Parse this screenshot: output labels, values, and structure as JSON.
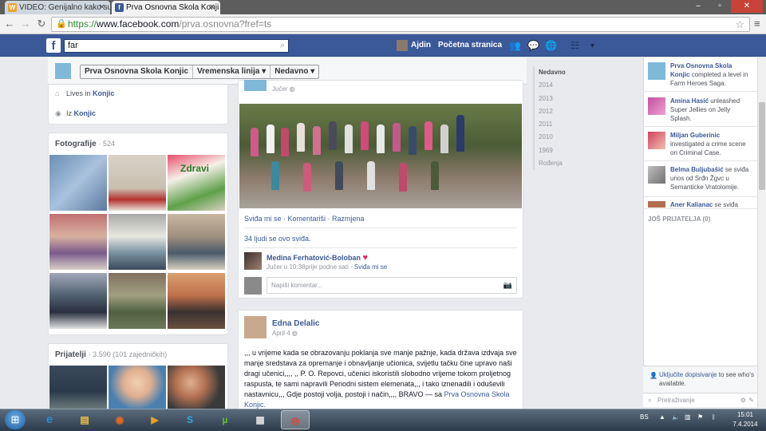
{
  "browser": {
    "tabs": [
      {
        "label": "VIDEO: Genijalno kako su",
        "favicon": "W"
      },
      {
        "label": "Prva Osnovna Skola Konji",
        "favicon": "f"
      }
    ],
    "url_scheme": "https://",
    "url_host": "www.facebook.com",
    "url_path": "/prva.osnovna?fref=ts"
  },
  "fb": {
    "search_value": "far",
    "user_name": "Ajdin",
    "home_label": "Početna stranica"
  },
  "timeline_header": {
    "page_name": "Prva Osnovna Skola Konjic",
    "view": "Vremenska linija",
    "sort": "Nedavno"
  },
  "about": {
    "lives_prefix": "Lives in",
    "lives_city": "Konjic",
    "from_prefix": "Iz",
    "from_city": "Konjic"
  },
  "photos": {
    "title": "Fotografije",
    "count": "· 524"
  },
  "friends": {
    "title": "Prijatelji",
    "count": "· 3.590 (101 zajedničkih)"
  },
  "post1": {
    "date": "Jučer",
    "actions": "Sviđa mi se · Komentariši · Razmjena",
    "likes": "34 ljudi se ovo sviđa.",
    "commenter": "Medina Ferhatović-Boloban",
    "comment_time": "Jučer u 10:38prije podne sati ·",
    "comment_like": "Sviđa mi se",
    "comment_placeholder": "Napiši komentar..."
  },
  "post2": {
    "author": "Edna Delalic",
    "date": "April 4",
    "text": ",,, u vrijeme kada se obrazovanju poklanja sve manje pažnje, kada država izdvaja sve manje sredstava za opremanje i obnavljanje učionica, svijetlu tačku čine upravo naši dragi učenici,,,, ,, P. O. Repovci, učenici iskoristili slobodno vrijeme tokom proljetnog raspusta, te sami napravili Periodni sistem elemenata,,, i tako iznenadili i oduševili nastavnicu,,, Gdje postoji volja, postoji i način,,,, BRAVO — sa",
    "tag": "Prva Osnovna Skola Konjic."
  },
  "years": [
    "Nedavno",
    "2014",
    "2013",
    "2012",
    "2011",
    "2010",
    "1969",
    "Rođenja"
  ],
  "ticker": [
    {
      "name": "Prva Osnovna Skola Konjic",
      "text": "completed a level in Farm Heroes Saga."
    },
    {
      "name": "Amina Hasić",
      "text": "unleashed Super Jellies on Jelly Splash."
    },
    {
      "name": "Miljan Guberinic",
      "text": "investigated a crime scene on Criminal Case."
    },
    {
      "name": "Belma Buljubašić",
      "text": "se sviđa unos od Srđn Žgvc u Semanticke Vratolomije."
    },
    {
      "name": "Aner Kalianac",
      "text": "se sviđa"
    }
  ],
  "ticker_more": "JOŠ PRIJATELJA (0)",
  "chat": {
    "notice_link": "Uključite dopisivanje",
    "notice_rest": "to see who's available.",
    "search_placeholder": "Pretraživanje"
  },
  "taskbar": {
    "lang": "BS",
    "time": "15:01",
    "date": "7.4.2014"
  },
  "colors": {
    "fb_blue": "#3b5998",
    "link": "#3b5998",
    "bg": "#e9eaed"
  }
}
